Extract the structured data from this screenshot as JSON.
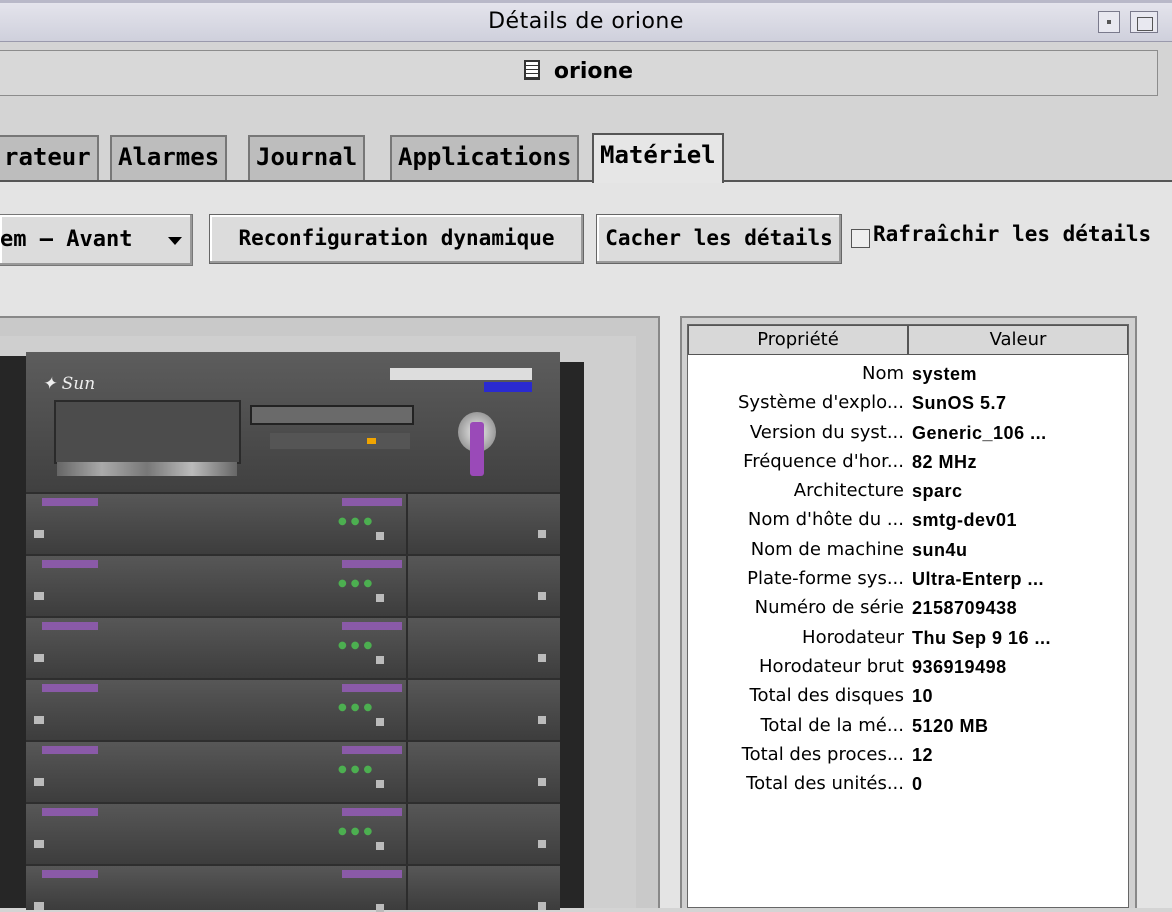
{
  "window": {
    "title": "Détails de orione"
  },
  "host": {
    "name": "orione"
  },
  "tabs": [
    {
      "label": "rateur"
    },
    {
      "label": "Alarmes"
    },
    {
      "label": "Journal"
    },
    {
      "label": "Applications"
    },
    {
      "label": "Matériel"
    }
  ],
  "toolbar": {
    "view_select": "em – Avant",
    "dynamic_reconfig": "Reconfiguration dynamique",
    "hide_details": "Cacher les détails",
    "refresh_details": "Rafraîchir les détails"
  },
  "image": {
    "brand": "Sun"
  },
  "properties": {
    "header": {
      "property": "Propriété",
      "value": "Valeur"
    },
    "rows": [
      {
        "k": "Nom",
        "v": "system"
      },
      {
        "k": "Système d'explo...",
        "v": "SunOS 5.7"
      },
      {
        "k": "Version du syst...",
        "v": "Generic_106 ..."
      },
      {
        "k": "Fréquence d'hor...",
        "v": "82 MHz"
      },
      {
        "k": "Architecture",
        "v": "sparc"
      },
      {
        "k": "Nom d'hôte du ...",
        "v": "smtg-dev01"
      },
      {
        "k": "Nom de machine",
        "v": "sun4u"
      },
      {
        "k": "Plate-forme sys...",
        "v": "Ultra-Enterp ..."
      },
      {
        "k": "Numéro de série",
        "v": "2158709438"
      },
      {
        "k": "Horodateur",
        "v": "Thu Sep 9 16 ..."
      },
      {
        "k": "Horodateur brut",
        "v": "936919498"
      },
      {
        "k": "Total des disques",
        "v": "10"
      },
      {
        "k": "Total de la mé...",
        "v": "5120 MB"
      },
      {
        "k": "Total des proces...",
        "v": "12"
      },
      {
        "k": "Total des unités...",
        "v": "0"
      }
    ]
  }
}
